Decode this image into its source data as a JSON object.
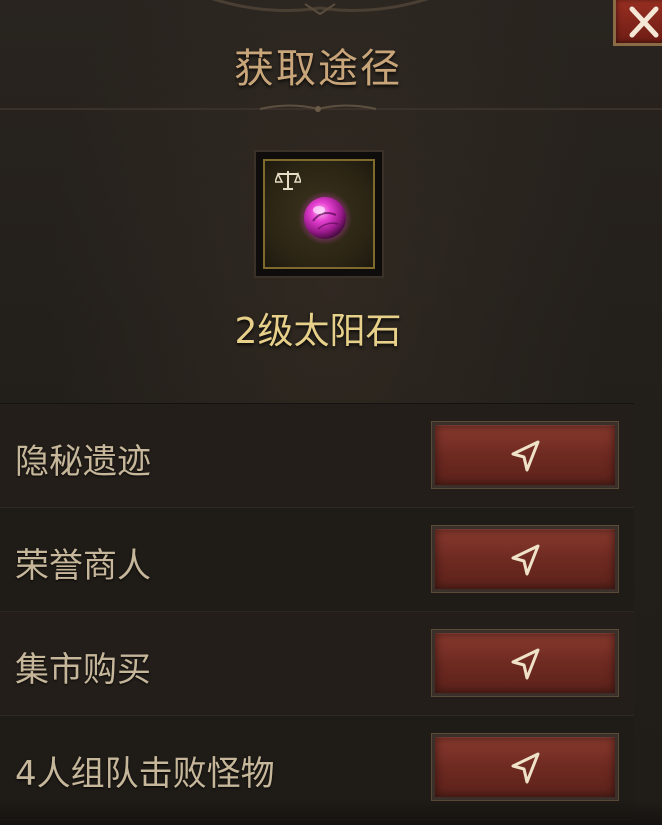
{
  "dialog": {
    "title": "获取途径",
    "close_icon": "close-x-icon",
    "accent_color": "#c9a57a",
    "close_color": "#8a2a1e"
  },
  "item": {
    "name": "2级太阳石",
    "icon": "purple-gem-orb-icon",
    "badge_icon": "scale-icon",
    "name_color": "#e6d08a"
  },
  "sources": [
    {
      "label": "隐秘遗迹",
      "action_icon": "navigate-arrow-icon"
    },
    {
      "label": "荣誉商人",
      "action_icon": "navigate-arrow-icon"
    },
    {
      "label": "集市购买",
      "action_icon": "navigate-arrow-icon"
    },
    {
      "label": "4人组队击败怪物",
      "action_icon": "navigate-arrow-icon"
    }
  ]
}
